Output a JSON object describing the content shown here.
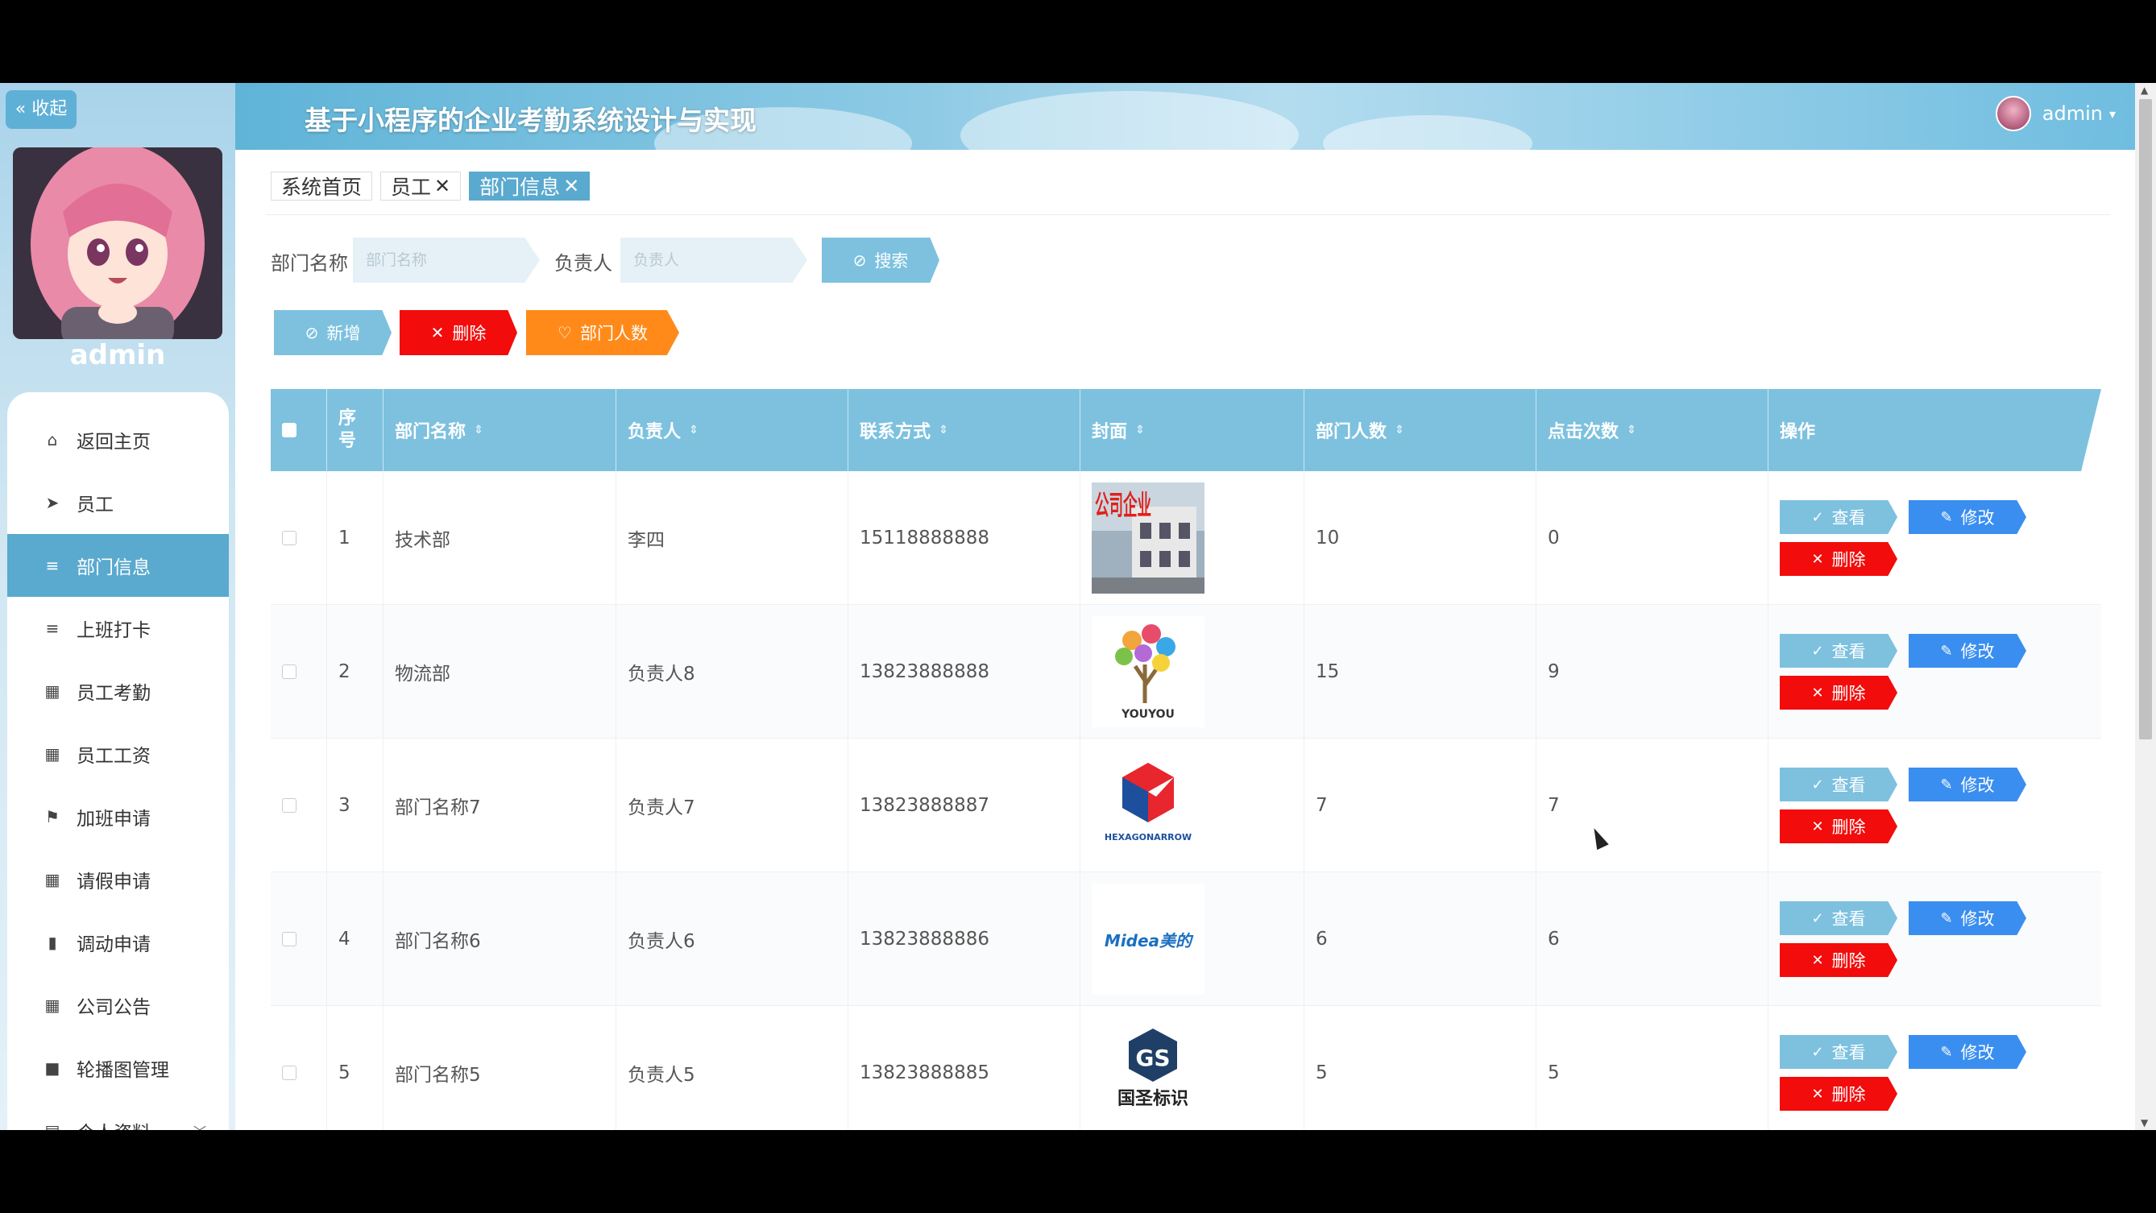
{
  "sidebar": {
    "collapse_label": "« 收起",
    "admin_name": "admin",
    "menu": [
      {
        "label": "返回主页",
        "icon": "home-icon"
      },
      {
        "label": "员工",
        "icon": "paper-plane-icon"
      },
      {
        "label": "部门信息",
        "icon": "list-icon",
        "active": true
      },
      {
        "label": "上班打卡",
        "icon": "list-icon"
      },
      {
        "label": "员工考勤",
        "icon": "grid-icon"
      },
      {
        "label": "员工工资",
        "icon": "grid-icon"
      },
      {
        "label": "加班申请",
        "icon": "flag-icon"
      },
      {
        "label": "请假申请",
        "icon": "grid-icon"
      },
      {
        "label": "调动申请",
        "icon": "bar-chart-icon"
      },
      {
        "label": "公司公告",
        "icon": "grid-icon"
      },
      {
        "label": "轮播图管理",
        "icon": "video-camera-icon"
      },
      {
        "label": "个人资料",
        "icon": "calendar-icon",
        "has_children": true
      }
    ]
  },
  "header": {
    "title": "基于小程序的企业考勤系统设计与实现",
    "user": "admin"
  },
  "tabs": [
    {
      "label": "系统首页",
      "closable": false
    },
    {
      "label": "员工",
      "closable": true
    },
    {
      "label": "部门信息",
      "closable": true,
      "active": true
    }
  ],
  "search": {
    "dept_label": "部门名称",
    "dept_placeholder": "部门名称",
    "leader_label": "负责人",
    "leader_placeholder": "负责人",
    "search_button": "搜索"
  },
  "actions": {
    "add": "新增",
    "delete": "删除",
    "dept_count": "部门人数"
  },
  "table": {
    "headers": {
      "index": "序号",
      "name": "部门名称",
      "leader": "负责人",
      "contact": "联系方式",
      "cover": "封面",
      "count": "部门人数",
      "clicks": "点击次数",
      "ops": "操作"
    },
    "op_labels": {
      "view": "查看",
      "edit": "修改",
      "delete": "删除"
    },
    "rows": [
      {
        "index": "1",
        "name": "技术部",
        "leader": "李四",
        "contact": "15118888888",
        "count": "10",
        "clicks": "0",
        "cover_text": "公司企业"
      },
      {
        "index": "2",
        "name": "物流部",
        "leader": "负责人8",
        "contact": "13823888888",
        "count": "15",
        "clicks": "9",
        "cover_text": "YOUYOU"
      },
      {
        "index": "3",
        "name": "部门名称7",
        "leader": "负责人7",
        "contact": "13823888887",
        "count": "7",
        "clicks": "7",
        "cover_text": "HEXAGONARROW"
      },
      {
        "index": "4",
        "name": "部门名称6",
        "leader": "负责人6",
        "contact": "13823888886",
        "count": "6",
        "clicks": "6",
        "cover_text": "Midea美的"
      },
      {
        "index": "5",
        "name": "部门名称5",
        "leader": "负责人5",
        "contact": "13823888885",
        "count": "5",
        "clicks": "5",
        "cover_text": "国圣标识"
      }
    ]
  },
  "colors": {
    "accent": "#5aa9cf",
    "header_row": "#7dc1df",
    "edit": "#3a8ef0",
    "delete": "#f20c0c",
    "dept_count_button": "#ff8a1a"
  }
}
